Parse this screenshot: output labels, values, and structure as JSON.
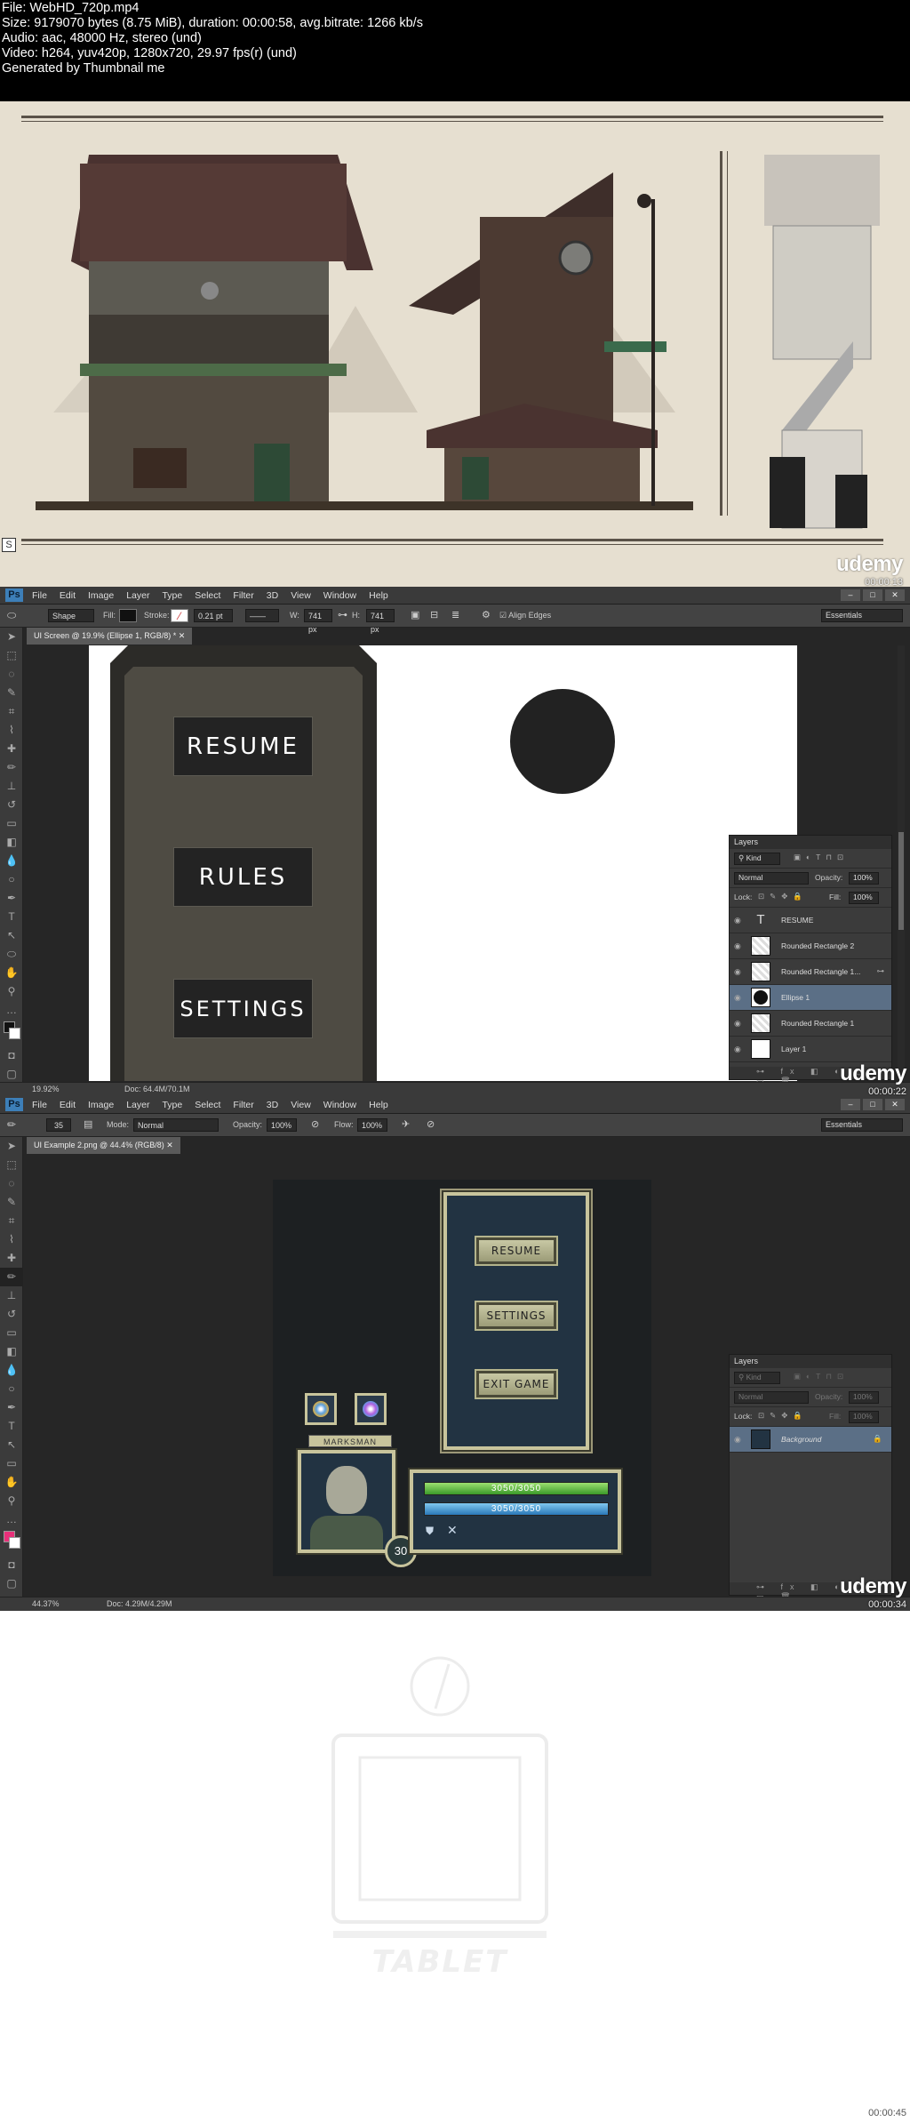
{
  "info": {
    "lines": [
      "File: WebHD_720p.mp4",
      "Size: 9179070 bytes (8.75 MiB), duration: 00:00:58, avg.bitrate: 1266 kb/s",
      "Audio: aac, 48000 Hz, stereo (und)",
      "Video: h264, yuv420p, 1280x720, 29.97 fps(r) (und)",
      "Generated by Thumbnail me"
    ]
  },
  "watermark": {
    "brand": "udemy"
  },
  "timestamps": [
    "00:00:13",
    "00:00:22",
    "00:00:34",
    "00:00:45"
  ],
  "frame1": {
    "corner_letter": "S"
  },
  "frame2": {
    "menu": [
      "File",
      "Edit",
      "Image",
      "Layer",
      "Type",
      "Select",
      "Filter",
      "3D",
      "View",
      "Window",
      "Help"
    ],
    "options": {
      "mode": "Shape",
      "fill_label": "Fill:",
      "stroke_label": "Stroke:",
      "stroke_width": "0.21 pt",
      "w_label": "W:",
      "w_value": "741 px",
      "h_label": "H:",
      "h_value": "741 px",
      "align_edges": "Align Edges"
    },
    "workspace": "Essentials",
    "tab": "UI Screen @ 19.9% (Ellipse 1, RGB/8) *",
    "buttons": [
      "RESUME",
      "RULES",
      "SETTINGS"
    ],
    "status": {
      "zoom": "19.92%",
      "doc": "Doc: 64.4M/70.1M"
    },
    "layers_panel": {
      "title": "Layers",
      "kind": "Kind",
      "blend": "Normal",
      "opacity_label": "Opacity:",
      "opacity": "100%",
      "lock_label": "Lock:",
      "fill_label": "Fill:",
      "fill": "100%",
      "layers": [
        {
          "name": "RESUME",
          "type": "text"
        },
        {
          "name": "Rounded Rectangle 2",
          "type": "shape"
        },
        {
          "name": "Rounded Rectangle 1...",
          "type": "shape"
        },
        {
          "name": "Ellipse 1",
          "type": "ellipse",
          "selected": true
        },
        {
          "name": "Rounded Rectangle 1",
          "type": "shape"
        },
        {
          "name": "Layer 1",
          "type": "raster"
        }
      ]
    }
  },
  "frame3": {
    "menu": [
      "File",
      "Edit",
      "Image",
      "Layer",
      "Type",
      "Select",
      "Filter",
      "3D",
      "View",
      "Window",
      "Help"
    ],
    "options": {
      "brush_size": "35",
      "mode_label": "Mode:",
      "mode": "Normal",
      "opacity_label": "Opacity:",
      "opacity": "100%",
      "flow_label": "Flow:",
      "flow": "100%"
    },
    "workspace": "Essentials",
    "tab": "UI Example 2.png @ 44.4% (RGB/8)",
    "buttons": [
      "RESUME",
      "SETTINGS",
      "EXIT GAME"
    ],
    "hud": {
      "class": "MARKSMAN",
      "health": "3050/3050",
      "mana": "3050/3050",
      "level": "30"
    },
    "status": {
      "zoom": "44.37%",
      "doc": "Doc: 4.29M/4.29M"
    },
    "layers_panel": {
      "title": "Layers",
      "kind": "Kind",
      "blend": "Normal",
      "opacity_label": "Opacity:",
      "opacity": "100%",
      "lock_label": "Lock:",
      "fill_label": "Fill:",
      "fill": "100%",
      "layers": [
        {
          "name": "Background",
          "selected": true
        }
      ]
    }
  },
  "frame4": {
    "label": "TABLET"
  }
}
